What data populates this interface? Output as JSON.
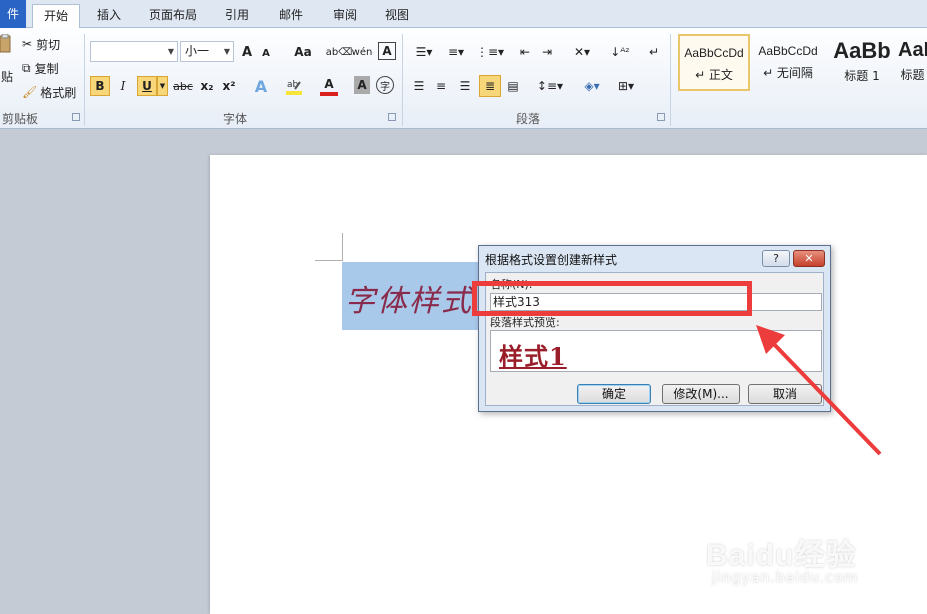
{
  "tabs": [
    {
      "label": "件"
    },
    {
      "label": "开始"
    },
    {
      "label": "插入"
    },
    {
      "label": "页面布局"
    },
    {
      "label": "引用"
    },
    {
      "label": "邮件"
    },
    {
      "label": "审阅"
    },
    {
      "label": "视图"
    }
  ],
  "clipboard": {
    "paste_label": "贴",
    "cut_label": "剪切",
    "copy_label": "复制",
    "format_painter_label": "格式刷",
    "group_label": "剪贴板"
  },
  "font": {
    "font_name_value": "",
    "font_size_value": "小一",
    "grow_label": "A",
    "shrink_label": "A",
    "case_label": "Aa",
    "bold_label": "B",
    "italic_label": "I",
    "underline_label": "U",
    "strikethrough_label": "abc",
    "subscript_label": "x₂",
    "superscript_label": "x²",
    "text_effect_label": "A",
    "font_color_label": "A",
    "char_shading_label": "A",
    "enclose_label": "字",
    "highlight_color": "#f7e43a",
    "font_color": "#d9201f",
    "group_label": "字体"
  },
  "paragraph": {
    "group_label": "段落"
  },
  "styles": {
    "items": [
      {
        "sample": "AaBbCcDd",
        "name": "↵ 正文"
      },
      {
        "sample": "AaBbCcDd",
        "name": "↵ 无间隔"
      },
      {
        "sample": "AaBb",
        "name": "标题 1"
      },
      {
        "sample": "AaI",
        "name": "标题"
      }
    ]
  },
  "document": {
    "selected_text": "字体样式"
  },
  "dialog": {
    "title": "根据格式设置创建新样式",
    "help_label": "?",
    "close_label": "✕",
    "name_label": "名称(N):",
    "name_value": "样式313",
    "preview_label": "段落样式预览:",
    "preview_text": "样式1",
    "ok_label": "确定",
    "modify_label": "修改(M)...",
    "cancel_label": "取消"
  },
  "annotation": {
    "color": "#ec3c3c"
  },
  "watermark": {
    "logo": "Baidu经验",
    "url": "jingyan.baidu.com"
  }
}
